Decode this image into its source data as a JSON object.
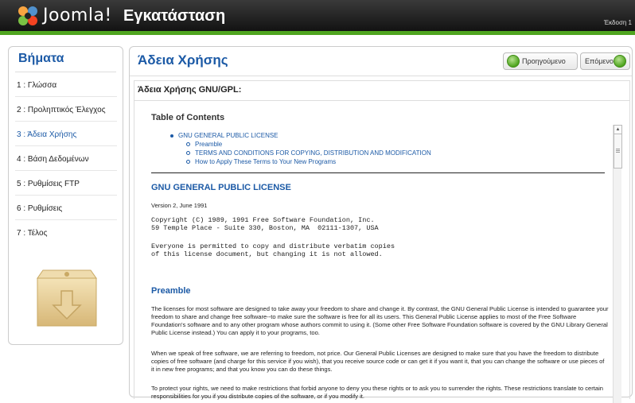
{
  "header": {
    "brand": "Joomla!",
    "page_title": "Εγκατάσταση",
    "version": "Έκδοση 1"
  },
  "sidebar": {
    "title": "Βήματα",
    "steps": [
      {
        "label": "1 : Γλώσσα",
        "active": false
      },
      {
        "label": "2 : Προληπτικός Έλεγχος",
        "active": false
      },
      {
        "label": "3 : Άδεια Χρήσης",
        "active": true
      },
      {
        "label": "4 : Βάση Δεδομένων",
        "active": false
      },
      {
        "label": "5 : Ρυθμίσεις FTP",
        "active": false
      },
      {
        "label": "6 : Ρυθμίσεις",
        "active": false
      },
      {
        "label": "7 : Τέλος",
        "active": false
      }
    ]
  },
  "main": {
    "title": "Άδεια Χρήσης",
    "prev_label": "Προηγούμενο",
    "next_label": "Επόμενο",
    "panel_title": "Άδεια Χρήσης GNU/GPL:"
  },
  "license": {
    "toc_title": "Table of Contents",
    "toc_items": [
      "GNU GENERAL PUBLIC LICENSE",
      "Preamble",
      "TERMS AND CONDITIONS FOR COPYING, DISTRIBUTION AND MODIFICATION",
      "How to Apply These Terms to Your New Programs"
    ],
    "gnu_title": "GNU GENERAL PUBLIC LICENSE",
    "version_line": "Version 2, June 1991",
    "copyright_1": "Copyright (C) 1989, 1991 Free Software Foundation, Inc.",
    "copyright_2": "59 Temple Place - Suite 330, Boston, MA  02111-1307, USA",
    "permit_1": "Everyone is permitted to copy and distribute verbatim copies",
    "permit_2": "of this license document, but changing it is not allowed.",
    "preamble_title": "Preamble",
    "para1": "The licenses for most software are designed to take away your freedom to share and change it. By contrast, the GNU General Public License is intended to guarantee your freedom to share and change free software--to make sure the software is free for all its users. This General Public License applies to most of the Free Software Foundation's software and to any other program whose authors commit to using it. (Some other Free Software Foundation software is covered by the GNU Library General Public License instead.) You can apply it to your programs, too.",
    "para2": "When we speak of free software, we are referring to freedom, not price. Our General Public Licenses are designed to make sure that you have the freedom to distribute copies of free software (and charge for this service if you wish), that you receive source code or can get it if you want it, that you can change the software or use pieces of it in new free programs; and that you know you can do these things.",
    "para3": "To protect your rights, we need to make restrictions that forbid anyone to deny you these rights or to ask you to surrender the rights. These restrictions translate to certain responsibilities for you if you distribute copies of the software, or if you modify it."
  },
  "colors": {
    "accent": "#1c5aa6",
    "brand_green": "#4fa51f",
    "header_bg": "#0d0d0d"
  }
}
